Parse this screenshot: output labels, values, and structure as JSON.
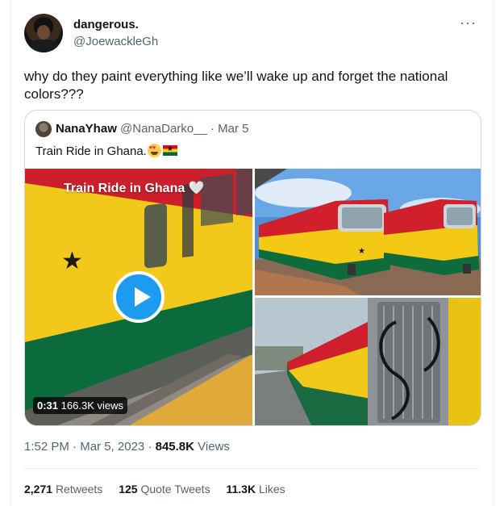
{
  "tweet": {
    "author_name": "dangerous.",
    "author_handle": "@JoewackleGh",
    "more_label": "···",
    "text": "why do they paint everything like we’ll wake up and forget the national colors???"
  },
  "quote": {
    "author_name": "NanaYhaw",
    "author_handle": "@NanaDarko__",
    "separator": "·",
    "date": "Mar 5",
    "text": "Train Ride in Ghana.",
    "emojis": [
      "smiling-face-with-heart-eyes",
      "flag-ghana"
    ],
    "video": {
      "caption": "Train Ride in Ghana 🤍",
      "duration": "0:31",
      "views": "166.3K views"
    }
  },
  "meta": {
    "time": "1:52 PM",
    "separator": "·",
    "date": "Mar 5, 2023",
    "separator2": "·",
    "views_count": "845.8K",
    "views_label": "Views"
  },
  "stats": [
    {
      "count": "2,271",
      "label": "Retweets"
    },
    {
      "count": "125",
      "label": "Quote Tweets"
    },
    {
      "count": "11.3K",
      "label": "Likes"
    }
  ],
  "colors": {
    "ghana_red": "#ce1126",
    "ghana_yellow": "#fcd116",
    "ghana_green": "#006b3f",
    "accent": "#1d9bf0",
    "muted_text": "#536471",
    "border": "#cfd9de"
  }
}
